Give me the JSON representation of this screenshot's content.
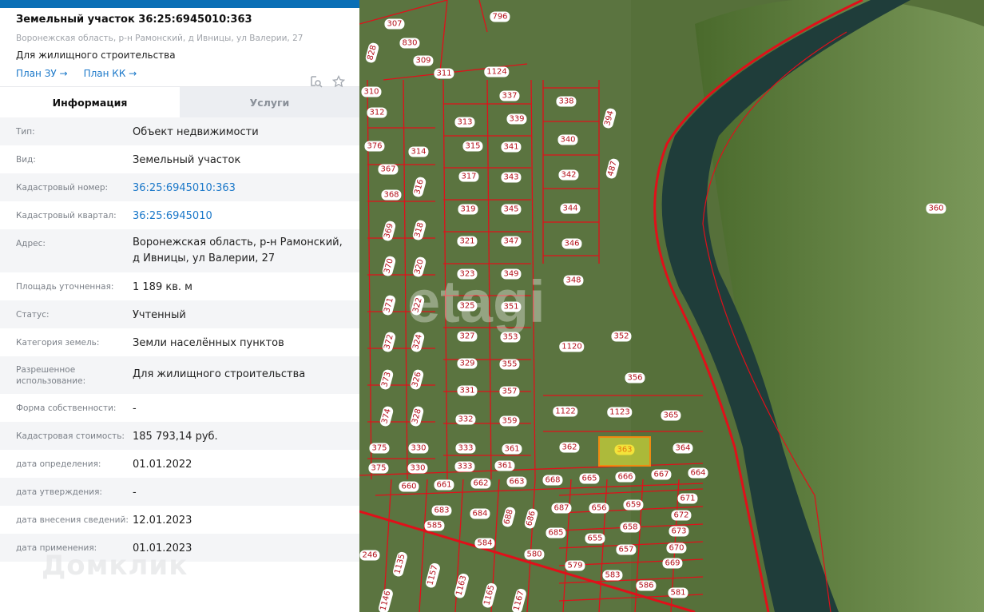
{
  "header": {
    "title": "Земельный участок 36:25:6945010:363",
    "address": "Воронежская область, р-н Рамонский, д Ивницы, ул Валерии, 27",
    "purpose": "Для жилищного строительства",
    "links": [
      "План ЗУ →",
      "План КК →"
    ],
    "icons": [
      "search-document-icon",
      "star-icon"
    ]
  },
  "tabs": [
    {
      "label": "Информация",
      "active": true
    },
    {
      "label": "Услуги",
      "active": false
    }
  ],
  "info": [
    {
      "k": "Тип:",
      "v": "Объект недвижимости"
    },
    {
      "k": "Вид:",
      "v": "Земельный участок"
    },
    {
      "k": "Кадастровый номер:",
      "v": "36:25:6945010:363",
      "link": true
    },
    {
      "k": "Кадастровый квартал:",
      "v": "36:25:6945010",
      "link": true
    },
    {
      "k": "Адрес:",
      "v": "Воронежская область, р-н Рамонский, д Ивницы, ул Валерии, 27"
    },
    {
      "k": "Площадь уточненная:",
      "v": "1 189 кв. м"
    },
    {
      "k": "Статус:",
      "v": "Учтенный"
    },
    {
      "k": "Категория земель:",
      "v": "Земли населённых пунктов"
    },
    {
      "k": "Разрешенное использование:",
      "v": "Для жилищного строительства"
    },
    {
      "k": "Форма собственности:",
      "v": "-"
    },
    {
      "k": "Кадастровая стоимость:",
      "v": "185 793,14 руб."
    },
    {
      "k": "дата определения:",
      "v": "01.01.2022"
    },
    {
      "k": "дата утверждения:",
      "v": "-"
    },
    {
      "k": "дата внесения сведений:",
      "v": "12.01.2023"
    },
    {
      "k": "дата применения:",
      "v": "01.01.2023"
    }
  ],
  "watermarks": {
    "panel": "Домклик",
    "map": "etagi"
  },
  "map": {
    "selected_parcel": "363",
    "colors": {
      "border": "#e0101a",
      "selected": "#f3e33a",
      "river": "#1f3d3a"
    },
    "parcels": [
      "796",
      "307",
      "830",
      "828",
      "309",
      "311",
      "1124",
      "310",
      "337",
      "338",
      "312",
      "313",
      "339",
      "394",
      "376",
      "314",
      "315",
      "341",
      "340",
      "367",
      "487",
      "317",
      "343",
      "342",
      "368",
      "316",
      "319",
      "345",
      "344",
      "369",
      "318",
      "321",
      "347",
      "346",
      "370",
      "320",
      "323",
      "349",
      "348",
      "371",
      "322",
      "325",
      "351",
      "360",
      "372",
      "324",
      "327",
      "353",
      "1120",
      "352",
      "329",
      "355",
      "356",
      "373",
      "326",
      "331",
      "357",
      "374",
      "328",
      "332",
      "359",
      "1122",
      "1123",
      "365",
      "375",
      "330",
      "333",
      "361",
      "362",
      "363",
      "364",
      "375",
      "330",
      "333",
      "361",
      "660",
      "661",
      "662",
      "663",
      "668",
      "665",
      "666",
      "667",
      "664",
      "671",
      "683",
      "684",
      "688",
      "686",
      "687",
      "656",
      "659",
      "672",
      "585",
      "685",
      "658",
      "673",
      "655",
      "657",
      "670",
      "584",
      "580",
      "579",
      "669",
      "583",
      "586",
      "581",
      "246",
      "1135",
      "1157",
      "1163",
      "1165",
      "1167",
      "1146"
    ]
  }
}
